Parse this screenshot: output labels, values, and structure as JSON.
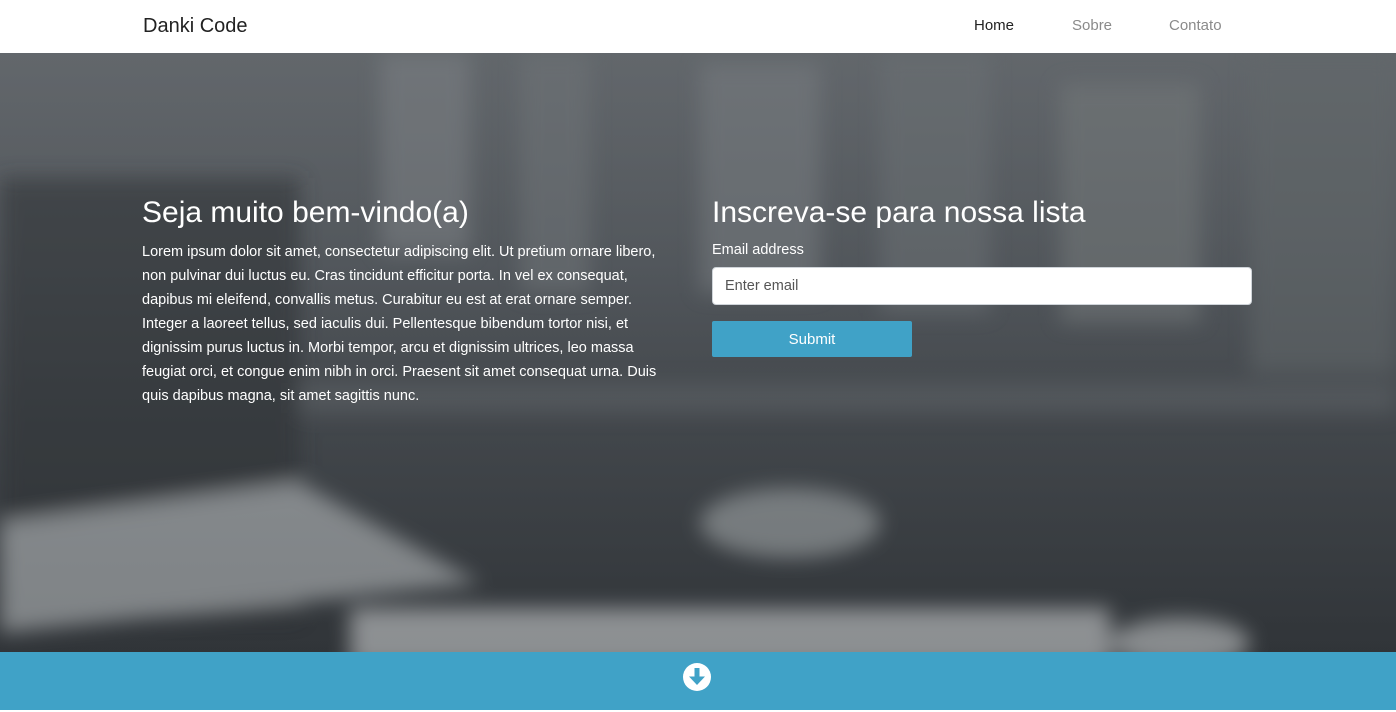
{
  "header": {
    "logo": "Danki Code",
    "nav": [
      {
        "label": "Home",
        "active": true
      },
      {
        "label": "Sobre",
        "active": false
      },
      {
        "label": "Contato",
        "active": false
      }
    ]
  },
  "hero": {
    "welcome_title": "Seja muito bem-vindo(a)",
    "welcome_text": "Lorem ipsum dolor sit amet, consectetur adipiscing elit. Ut pretium ornare libero, non pulvinar dui luctus eu. Cras tincidunt efficitur porta. In vel ex consequat, dapibus mi eleifend, convallis metus. Curabitur eu est at erat ornare semper. Integer a laoreet tellus, sed iaculis dui. Pellentesque bibendum tortor nisi, et dignissim purus luctus in. Morbi tempor, arcu et dignissim ultrices, leo massa feugiat orci, et congue enim nibh in orci. Praesent sit amet consequat urna. Duis quis dapibus magna, sit amet sagittis nunc.",
    "signup_title": "Inscreva-se para nossa lista",
    "email_label": "Email address",
    "email_placeholder": "Enter email",
    "submit_label": "Submit"
  },
  "footer_bar": {
    "icon": "arrow-down-circle-icon"
  },
  "colors": {
    "accent": "#40a2c7",
    "header_bg": "#ffffff",
    "hero_overlay": "#4a4f54"
  }
}
